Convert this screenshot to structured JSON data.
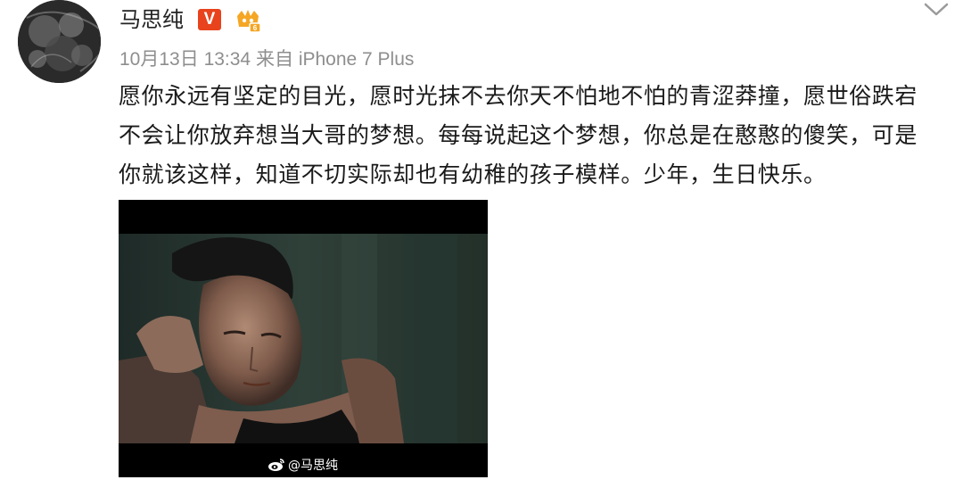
{
  "user": {
    "name": "马思纯",
    "verified_label": "V",
    "avatar_icon": "avatar-image",
    "vip_icon": "vip-crown-icon"
  },
  "post": {
    "date": "10月13日",
    "time": "13:34",
    "source_prefix": "来自",
    "source_device": "iPhone 7 Plus",
    "lines": [
      "愿你永远有坚定的目光，愿时光抹不去你天不怕地不怕的青涩莽撞，愿世俗跌宕",
      "不会让你放弃想当大哥的梦想。每每说起这个梦想，你总是在憨憨的傻笑，可是",
      "你就该这样，知道不切实际却也有幼稚的孩子模样。少年，生日快乐。"
    ],
    "image_watermark": "@马思纯",
    "image_icon": "weibo-logo-icon"
  },
  "menu": {
    "icon": "chevron-down-icon"
  },
  "colors": {
    "verified": "#e8431c",
    "meta_text": "#8e8e8e",
    "body_text": "#1a1a1a",
    "vip_gold": "#f5a623"
  }
}
